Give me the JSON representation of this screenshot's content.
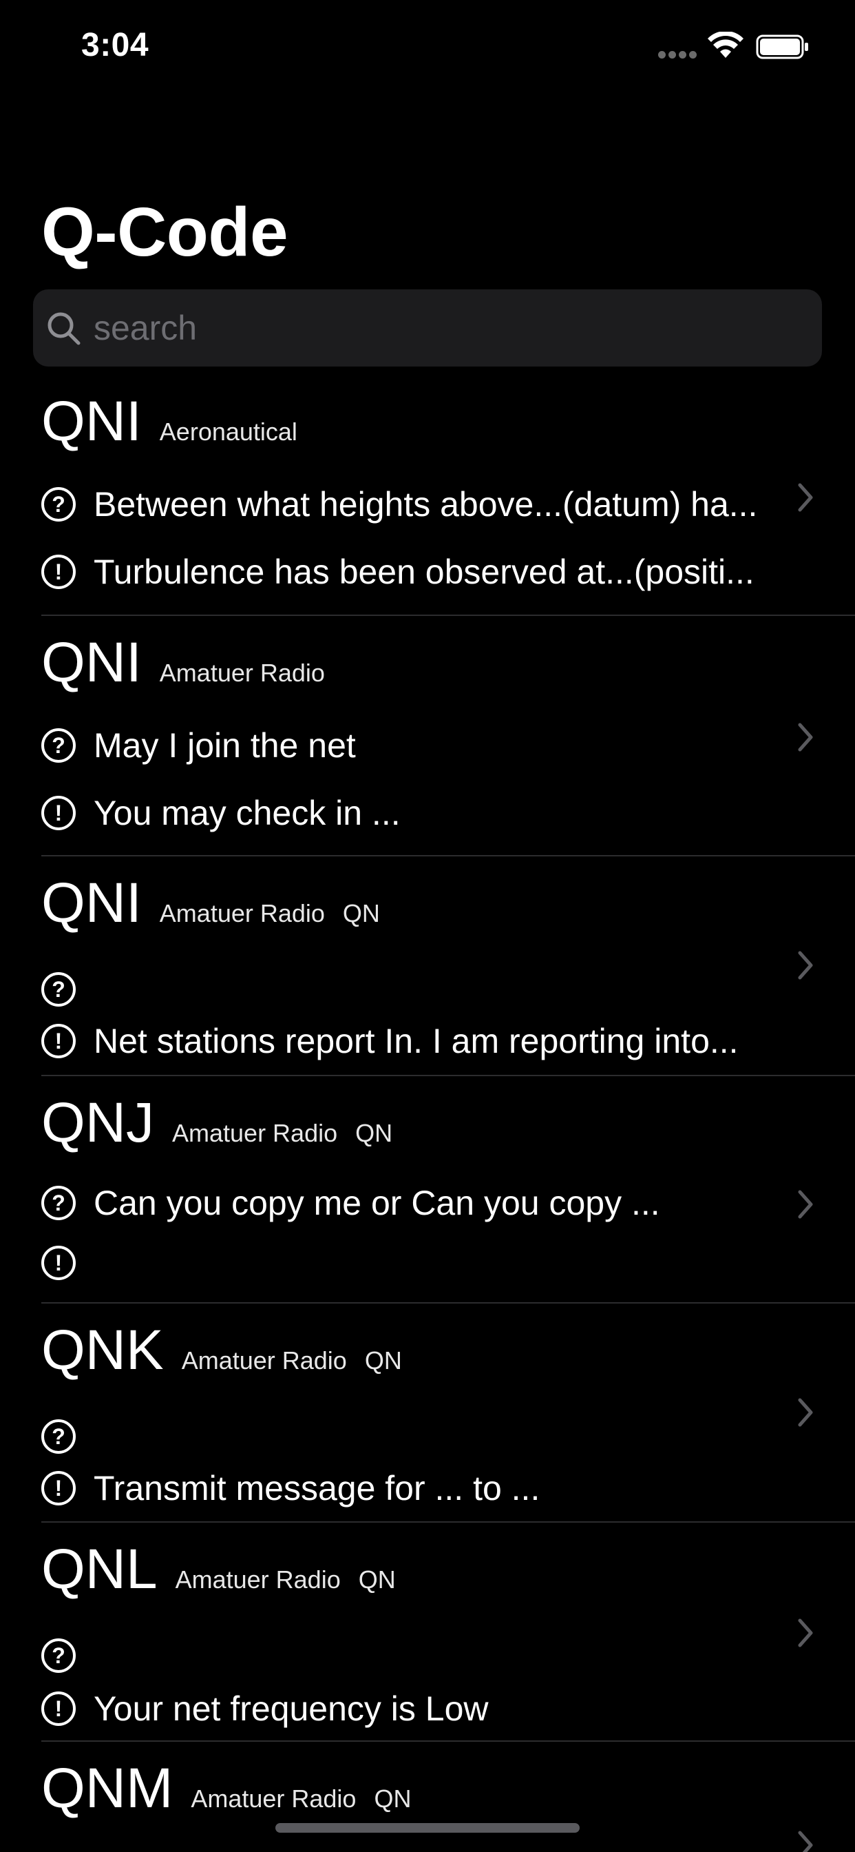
{
  "status_bar": {
    "time": "3:04"
  },
  "page": {
    "title": "Q-Code"
  },
  "search": {
    "placeholder": "search",
    "value": ""
  },
  "icons": {
    "question": "?",
    "info": "!"
  },
  "rows": [
    {
      "code": "QNI",
      "category": "Aeronautical",
      "subcategory": "",
      "question": "Between what heights above...(datum) ha...",
      "answer": "Turbulence has been observed at...(positi..."
    },
    {
      "code": "QNI",
      "category": "Amatuer Radio",
      "subcategory": "",
      "question": "May I join the net",
      "answer": "You may check in ..."
    },
    {
      "code": "QNI",
      "category": "Amatuer Radio",
      "subcategory": "QN",
      "question": "",
      "answer": "Net stations report In. I am reporting into..."
    },
    {
      "code": "QNJ",
      "category": "Amatuer Radio",
      "subcategory": "QN",
      "question": "Can you copy me or Can you copy ...",
      "answer": ""
    },
    {
      "code": "QNK",
      "category": "Amatuer Radio",
      "subcategory": "QN",
      "question": "",
      "answer": "Transmit message for ... to ..."
    },
    {
      "code": "QNL",
      "category": "Amatuer Radio",
      "subcategory": "QN",
      "question": "",
      "answer": "Your net frequency is Low"
    },
    {
      "code": "QNM",
      "category": "Amatuer Radio",
      "subcategory": "QN",
      "question": "",
      "answer": ""
    }
  ]
}
